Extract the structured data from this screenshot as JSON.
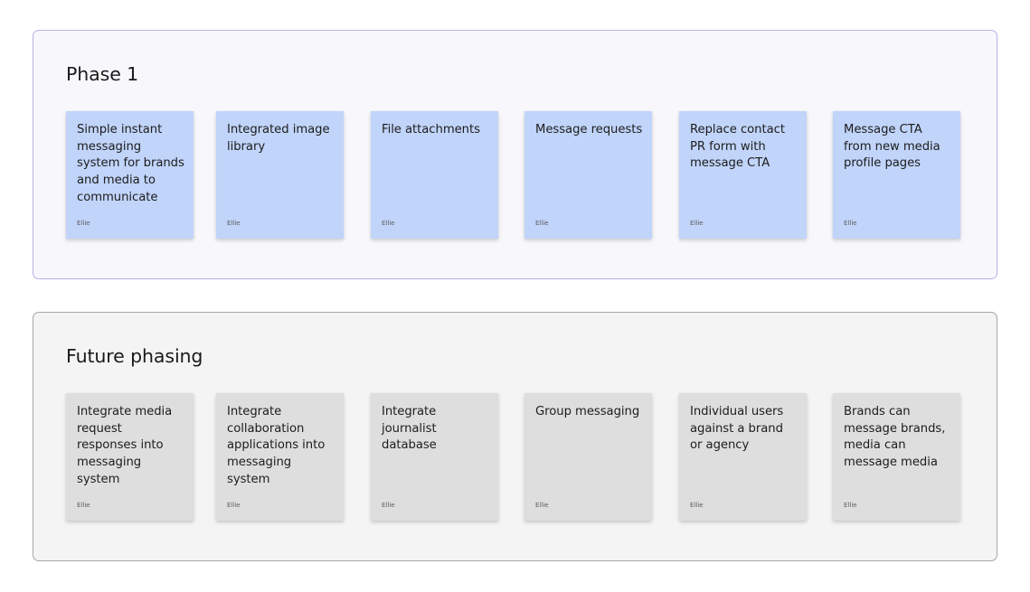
{
  "frames": [
    {
      "title": "Phase 1",
      "notes": [
        {
          "text": "Simple instant messaging system for brands and media to communicate",
          "author": "Ellie"
        },
        {
          "text": "Integrated image library",
          "author": "Ellie"
        },
        {
          "text": "File attachments",
          "author": "Ellie"
        },
        {
          "text": "Message requests",
          "author": "Ellie"
        },
        {
          "text": "Replace contact PR form with message CTA",
          "author": "Ellie"
        },
        {
          "text": "Message CTA from new media profile pages",
          "author": "Ellie"
        }
      ]
    },
    {
      "title": "Future phasing",
      "notes": [
        {
          "text": "Integrate media request responses into messaging system",
          "author": "Ellie"
        },
        {
          "text": "Integrate collaboration applications into messaging system",
          "author": "Ellie"
        },
        {
          "text": "Integrate journalist database",
          "author": "Ellie"
        },
        {
          "text": "Group messaging",
          "author": "Ellie"
        },
        {
          "text": "Individual users against a brand or agency",
          "author": "Ellie"
        },
        {
          "text": "Brands can message brands, media can message media",
          "author": "Ellie"
        }
      ]
    }
  ],
  "colors": {
    "phase1_note": "#c1d4fa",
    "future_note": "#dedede",
    "phase1_border": "#b7b0e6",
    "future_border": "#a6a6a6"
  }
}
